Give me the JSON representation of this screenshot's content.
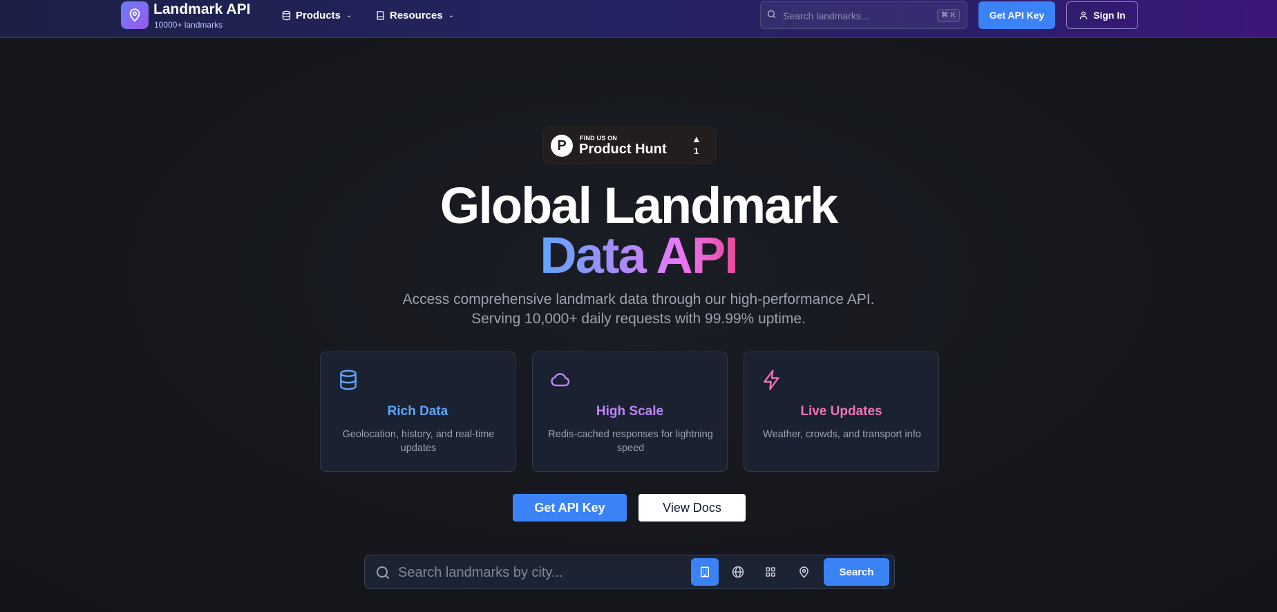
{
  "nav": {
    "brand_title": "Landmark API",
    "brand_subtitle": "10000+ landmarks",
    "menu": [
      {
        "label": "Products",
        "icon": "database-icon"
      },
      {
        "label": "Resources",
        "icon": "book-icon"
      }
    ],
    "search_placeholder": "Search landmarks...",
    "search_shortcut": "⌘ K",
    "api_key_label": "Get API Key",
    "sign_in_label": "Sign In"
  },
  "product_hunt": {
    "small_text": "FIND US ON",
    "big_text": "Product Hunt",
    "letter": "P",
    "upvote_count": "1"
  },
  "hero": {
    "title_line1": "Global Landmark",
    "title_line2": "Data API",
    "subtitle": "Access comprehensive landmark data through our high-performance API. Serving 10,000+ daily requests with 99.99% uptime."
  },
  "features": [
    {
      "title": "Rich Data",
      "description": "Geolocation, history, and real-time updates",
      "color": "#60a5fa",
      "icon": "database-icon"
    },
    {
      "title": "High Scale",
      "description": "Redis-cached responses for lightning speed",
      "color": "#c084fc",
      "icon": "cloud-icon"
    },
    {
      "title": "Live Updates",
      "description": "Weather, crowds, and transport info",
      "color": "#f472b6",
      "icon": "lightning-icon"
    }
  ],
  "cta": {
    "api_key_label": "Get API Key",
    "docs_label": "View Docs"
  },
  "bottom_search": {
    "placeholder": "Search landmarks by city...",
    "filters": [
      "building-icon",
      "globe-icon",
      "grid-icon",
      "map-pin-icon"
    ],
    "active_filter": "building-icon",
    "button_label": "Search"
  },
  "colors": {
    "accent": "#3b82f6",
    "background": "#15171c"
  }
}
